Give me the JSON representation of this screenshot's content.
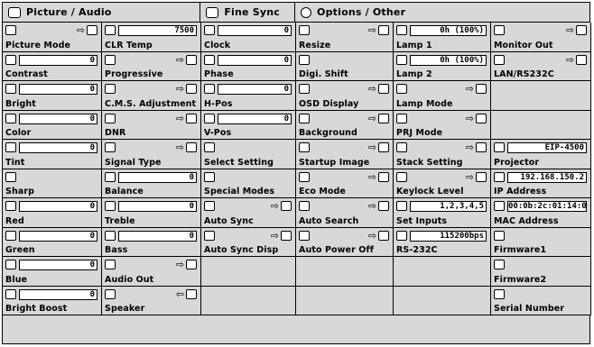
{
  "header": {
    "tab_picture_audio": "Picture  /  Audio",
    "tab_fine_sync": "Fine Sync",
    "tab_options_other": "Options  /  Other"
  },
  "cells": [
    [
      {
        "label": "Picture Mode",
        "value": "",
        "arrow": "⇨"
      },
      {
        "label": "CLR Temp",
        "value": "7500",
        "arrow": ""
      },
      {
        "label": "Clock",
        "value": "0",
        "arrow": ""
      },
      {
        "label": "Resize",
        "value": "",
        "arrow": "⇨"
      },
      {
        "label": "Lamp 1",
        "value": "0h  (100%)",
        "arrow": ""
      },
      {
        "label": "Monitor Out",
        "value": "",
        "arrow": "⇨"
      }
    ],
    [
      {
        "label": "Contrast",
        "value": "0",
        "arrow": ""
      },
      {
        "label": "Progressive",
        "value": "",
        "arrow": "⇨"
      },
      {
        "label": "Phase",
        "value": "0",
        "arrow": ""
      },
      {
        "label": "Digi. Shift",
        "value": "",
        "arrow": ""
      },
      {
        "label": "Lamp 2",
        "value": "0h  (100%)",
        "arrow": ""
      },
      {
        "label": "LAN/RS232C",
        "value": "",
        "arrow": "⇨"
      }
    ],
    [
      {
        "label": "Bright",
        "value": "0",
        "arrow": ""
      },
      {
        "label": "C.M.S. Adjustment",
        "value": "",
        "arrow": "⇨"
      },
      {
        "label": "H-Pos",
        "value": "0",
        "arrow": ""
      },
      {
        "label": "OSD Display",
        "value": "",
        "arrow": "⇨"
      },
      {
        "label": "Lamp Mode",
        "value": "",
        "arrow": "⇨"
      },
      {
        "label": "",
        "value": "",
        "arrow": ""
      }
    ],
    [
      {
        "label": "Color",
        "value": "0",
        "arrow": ""
      },
      {
        "label": "DNR",
        "value": "",
        "arrow": "⇨"
      },
      {
        "label": "V-Pos",
        "value": "0",
        "arrow": ""
      },
      {
        "label": "Background",
        "value": "",
        "arrow": "⇨"
      },
      {
        "label": "PRJ Mode",
        "value": "",
        "arrow": "⇨"
      },
      {
        "label": "",
        "value": "",
        "arrow": ""
      }
    ],
    [
      {
        "label": "Tint",
        "value": "0",
        "arrow": ""
      },
      {
        "label": "Signal Type",
        "value": "",
        "arrow": "⇨"
      },
      {
        "label": "Select Setting",
        "value": "",
        "arrow": ""
      },
      {
        "label": "Startup Image",
        "value": "",
        "arrow": "⇨"
      },
      {
        "label": "Stack Setting",
        "value": "",
        "arrow": "⇨"
      },
      {
        "label": "Projector",
        "value": "EIP-4500",
        "arrow": ""
      }
    ],
    [
      {
        "label": "Sharp",
        "value": "",
        "arrow": ""
      },
      {
        "label": "Balance",
        "value": "0",
        "arrow": ""
      },
      {
        "label": "Special Modes",
        "value": "",
        "arrow": ""
      },
      {
        "label": "Eco Mode",
        "value": "",
        "arrow": "⇨"
      },
      {
        "label": "Keylock Level",
        "value": "",
        "arrow": "⇨"
      },
      {
        "label": "IP Address",
        "value": "192.168.150.2",
        "arrow": ""
      }
    ],
    [
      {
        "label": "Red",
        "value": "0",
        "arrow": ""
      },
      {
        "label": "Treble",
        "value": "0",
        "arrow": ""
      },
      {
        "label": "Auto Sync",
        "value": "",
        "arrow": "⇨"
      },
      {
        "label": "Auto Search",
        "value": "",
        "arrow": "⇨"
      },
      {
        "label": "Set Inputs",
        "value": "1,2,3,4,5",
        "arrow": ""
      },
      {
        "label": "MAC Address",
        "value": "00:0b:2c:01:14:00",
        "arrow": ""
      }
    ],
    [
      {
        "label": "Green",
        "value": "0",
        "arrow": ""
      },
      {
        "label": "Bass",
        "value": "0",
        "arrow": ""
      },
      {
        "label": "Auto Sync Disp",
        "value": "",
        "arrow": "⇨"
      },
      {
        "label": "Auto Power Off",
        "value": "",
        "arrow": "⇨"
      },
      {
        "label": "RS-232C",
        "value": "115200bps",
        "arrow": ""
      },
      {
        "label": "Firmware1",
        "value": "",
        "arrow": ""
      }
    ],
    [
      {
        "label": "Blue",
        "value": "0",
        "arrow": ""
      },
      {
        "label": "Audio Out",
        "value": "",
        "arrow": "⇨"
      },
      {
        "label": "",
        "value": "",
        "arrow": ""
      },
      {
        "label": "",
        "value": "",
        "arrow": ""
      },
      {
        "label": "",
        "value": "",
        "arrow": ""
      },
      {
        "label": "Firmware2",
        "value": "",
        "arrow": ""
      }
    ],
    [
      {
        "label": "Bright Boost",
        "value": "0",
        "arrow": ""
      },
      {
        "label": "Speaker",
        "value": "",
        "arrow": "⇦"
      },
      {
        "label": "",
        "value": "",
        "arrow": ""
      },
      {
        "label": "",
        "value": "",
        "arrow": ""
      },
      {
        "label": "",
        "value": "",
        "arrow": ""
      },
      {
        "label": "Serial Number",
        "value": "",
        "arrow": ""
      }
    ]
  ]
}
